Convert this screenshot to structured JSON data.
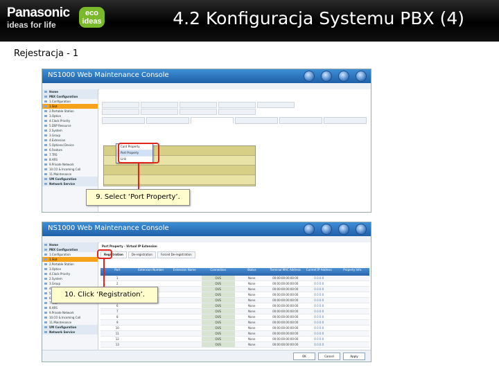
{
  "header": {
    "brand_name": "Panasonic",
    "brand_tagline": "ideas for life",
    "eco_badge_line1": "eco",
    "eco_badge_line2": "ideas",
    "title": "4.2 Konfiguracja Systemu PBX (4)"
  },
  "subtitle": "Rejestracja - 1",
  "colors": {
    "header_bg": "#000000",
    "eco_green": "#7ab929",
    "console_blue": "#1f5fa8",
    "highlight_red": "#e0241b",
    "callout_bg": "#fffccd",
    "active_item": "#f6a21a"
  },
  "screenshot1": {
    "console_title": "NS1000 Web Maintenance Console",
    "sidebar_items": [
      {
        "label": "Home",
        "type": "group"
      },
      {
        "label": "PBX Configuration",
        "type": "group"
      },
      {
        "label": "1.Configuration",
        "type": "item"
      },
      {
        "label": "1.Slot",
        "type": "active"
      },
      {
        "label": "2.Portable Station",
        "type": "item"
      },
      {
        "label": "3.Option",
        "type": "item"
      },
      {
        "label": "4.Clock Priority",
        "type": "item"
      },
      {
        "label": "5.DSP Resource",
        "type": "item"
      },
      {
        "label": "2.System",
        "type": "item"
      },
      {
        "label": "3.Group",
        "type": "item"
      },
      {
        "label": "4.Extension",
        "type": "item"
      },
      {
        "label": "5.Optional Device",
        "type": "item"
      },
      {
        "label": "6.Feature",
        "type": "item"
      },
      {
        "label": "7.TRS",
        "type": "item"
      },
      {
        "label": "8.ARS",
        "type": "item"
      },
      {
        "label": "9.Private Network",
        "type": "item"
      },
      {
        "label": "10.CO & Incoming Call",
        "type": "item"
      },
      {
        "label": "11.Maintenance",
        "type": "item"
      },
      {
        "label": "UM Configuration",
        "type": "group"
      },
      {
        "label": "Network Service",
        "type": "group"
      }
    ],
    "context_menu": [
      "Card Property",
      "Port Property",
      "Link"
    ],
    "callout": "9. Select ‘Port Property’."
  },
  "screenshot2": {
    "console_title": "NS1000 Web Maintenance Console",
    "panel_title": "Port Property - Virtual IP Extension",
    "tabs": [
      "Registration",
      "De-registration",
      "Forced De-registration"
    ],
    "sidebar_items": [
      {
        "label": "Home",
        "type": "group"
      },
      {
        "label": "PBX Configuration",
        "type": "group"
      },
      {
        "label": "1.Configuration",
        "type": "item"
      },
      {
        "label": "1.Slot",
        "type": "active"
      },
      {
        "label": "2.Portable Station",
        "type": "item"
      },
      {
        "label": "3.Option",
        "type": "item"
      },
      {
        "label": "4.Clock Priority",
        "type": "item"
      },
      {
        "label": "2.System",
        "type": "item"
      },
      {
        "label": "3.Group",
        "type": "item"
      },
      {
        "label": "4.Extension",
        "type": "item"
      },
      {
        "label": "5.Optional Device",
        "type": "item"
      },
      {
        "label": "6.Feature",
        "type": "item"
      },
      {
        "label": "7.TRS",
        "type": "item"
      },
      {
        "label": "8.ARS",
        "type": "item"
      },
      {
        "label": "9.Private Network",
        "type": "item"
      },
      {
        "label": "10.CO & Incoming Call",
        "type": "item"
      },
      {
        "label": "11.Maintenance",
        "type": "item"
      },
      {
        "label": "UM Configuration",
        "type": "group"
      },
      {
        "label": "Network Service",
        "type": "group"
      }
    ],
    "table_headers": [
      "Port",
      "Extension Number",
      "Extension Name",
      "Connection",
      "Status",
      "Terminal MAC Address",
      "Current IP Address",
      "Property Info."
    ],
    "table_rows": [
      [
        "1",
        "",
        "",
        "OUS",
        "None",
        "00:00:00:00:00:00",
        "0.0.0.0",
        ""
      ],
      [
        "2",
        "",
        "",
        "OUS",
        "None",
        "00:00:00:00:00:00",
        "0.0.0.0",
        ""
      ],
      [
        "3",
        "",
        "",
        "OUS",
        "None",
        "00:00:00:00:00:00",
        "0.0.0.0",
        ""
      ],
      [
        "4",
        "",
        "",
        "OUS",
        "None",
        "00:00:00:00:00:00",
        "0.0.0.0",
        ""
      ],
      [
        "5",
        "",
        "",
        "OUS",
        "None",
        "00:00:00:00:00:00",
        "0.0.0.0",
        ""
      ],
      [
        "6",
        "",
        "",
        "OUS",
        "None",
        "00:00:00:00:00:00",
        "0.0.0.0",
        ""
      ],
      [
        "7",
        "",
        "",
        "OUS",
        "None",
        "00:00:00:00:00:00",
        "0.0.0.0",
        ""
      ],
      [
        "8",
        "",
        "",
        "OUS",
        "None",
        "00:00:00:00:00:00",
        "0.0.0.0",
        ""
      ],
      [
        "9",
        "",
        "",
        "OUS",
        "None",
        "00:00:00:00:00:00",
        "0.0.0.0",
        ""
      ],
      [
        "10",
        "",
        "",
        "OUS",
        "None",
        "00:00:00:00:00:00",
        "0.0.0.0",
        ""
      ],
      [
        "11",
        "",
        "",
        "OUS",
        "None",
        "00:00:00:00:00:00",
        "0.0.0.0",
        ""
      ],
      [
        "12",
        "",
        "",
        "OUS",
        "None",
        "00:00:00:00:00:00",
        "0.0.0.0",
        ""
      ],
      [
        "13",
        "",
        "",
        "OUS",
        "None",
        "00:00:00:00:00:00",
        "0.0.0.0",
        ""
      ]
    ],
    "footer_buttons": [
      "OK",
      "Cancel",
      "Apply"
    ],
    "callout": "10. Click ‘Registration’."
  }
}
